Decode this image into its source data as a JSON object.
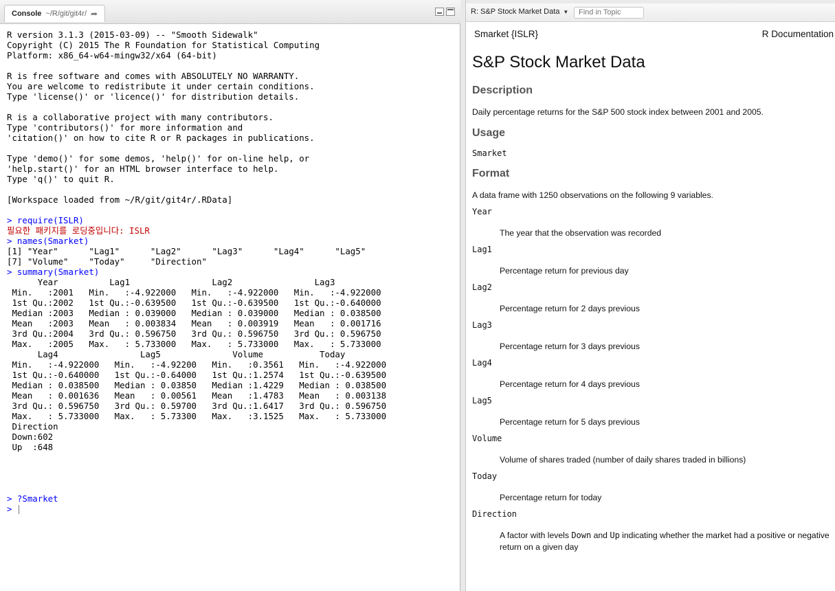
{
  "console": {
    "tab_title": "Console",
    "path": "~/R/git/git4r/",
    "lines": [
      {
        "kind": "out",
        "text": "R version 3.1.3 (2015-03-09) -- \"Smooth Sidewalk\""
      },
      {
        "kind": "out",
        "text": "Copyright (C) 2015 The R Foundation for Statistical Computing"
      },
      {
        "kind": "out",
        "text": "Platform: x86_64-w64-mingw32/x64 (64-bit)"
      },
      {
        "kind": "blank",
        "text": ""
      },
      {
        "kind": "out",
        "text": "R is free software and comes with ABSOLUTELY NO WARRANTY."
      },
      {
        "kind": "out",
        "text": "You are welcome to redistribute it under certain conditions."
      },
      {
        "kind": "out",
        "text": "Type 'license()' or 'licence()' for distribution details."
      },
      {
        "kind": "blank",
        "text": ""
      },
      {
        "kind": "out",
        "text": "R is a collaborative project with many contributors."
      },
      {
        "kind": "out",
        "text": "Type 'contributors()' for more information and"
      },
      {
        "kind": "out",
        "text": "'citation()' on how to cite R or R packages in publications."
      },
      {
        "kind": "blank",
        "text": ""
      },
      {
        "kind": "out",
        "text": "Type 'demo()' for some demos, 'help()' for on-line help, or"
      },
      {
        "kind": "out",
        "text": "'help.start()' for an HTML browser interface to help."
      },
      {
        "kind": "out",
        "text": "Type 'q()' to quit R."
      },
      {
        "kind": "blank",
        "text": ""
      },
      {
        "kind": "out",
        "text": "[Workspace loaded from ~/R/git/git4r/.RData]"
      },
      {
        "kind": "blank",
        "text": ""
      },
      {
        "kind": "cmd",
        "text": "> require(ISLR)"
      },
      {
        "kind": "err",
        "text": "필요한 패키지를 로딩중입니다: ISLR"
      },
      {
        "kind": "cmd",
        "text": "> names(Smarket)"
      },
      {
        "kind": "out",
        "text": "[1] \"Year\"      \"Lag1\"      \"Lag2\"      \"Lag3\"      \"Lag4\"      \"Lag5\""
      },
      {
        "kind": "out",
        "text": "[7] \"Volume\"    \"Today\"     \"Direction\""
      },
      {
        "kind": "cmd",
        "text": "> summary(Smarket)"
      },
      {
        "kind": "out",
        "text": "      Year          Lag1                Lag2                Lag3          "
      },
      {
        "kind": "out",
        "text": " Min.   :2001   Min.   :-4.922000   Min.   :-4.922000   Min.   :-4.922000  "
      },
      {
        "kind": "out",
        "text": " 1st Qu.:2002   1st Qu.:-0.639500   1st Qu.:-0.639500   1st Qu.:-0.640000  "
      },
      {
        "kind": "out",
        "text": " Median :2003   Median : 0.039000   Median : 0.039000   Median : 0.038500  "
      },
      {
        "kind": "out",
        "text": " Mean   :2003   Mean   : 0.003834   Mean   : 0.003919   Mean   : 0.001716  "
      },
      {
        "kind": "out",
        "text": " 3rd Qu.:2004   3rd Qu.: 0.596750   3rd Qu.: 0.596750   3rd Qu.: 0.596750  "
      },
      {
        "kind": "out",
        "text": " Max.   :2005   Max.   : 5.733000   Max.   : 5.733000   Max.   : 5.733000  "
      },
      {
        "kind": "out",
        "text": "      Lag4                Lag5              Volume           Today          "
      },
      {
        "kind": "out",
        "text": " Min.   :-4.922000   Min.   :-4.92200   Min.   :0.3561   Min.   :-4.922000  "
      },
      {
        "kind": "out",
        "text": " 1st Qu.:-0.640000   1st Qu.:-0.64000   1st Qu.:1.2574   1st Qu.:-0.639500  "
      },
      {
        "kind": "out",
        "text": " Median : 0.038500   Median : 0.03850   Median :1.4229   Median : 0.038500  "
      },
      {
        "kind": "out",
        "text": " Mean   : 0.001636   Mean   : 0.00561   Mean   :1.4783   Mean   : 0.003138  "
      },
      {
        "kind": "out",
        "text": " 3rd Qu.: 0.596750   3rd Qu.: 0.59700   3rd Qu.:1.6417   3rd Qu.: 0.596750  "
      },
      {
        "kind": "out",
        "text": " Max.   : 5.733000   Max.   : 5.73300   Max.   :3.1525   Max.   : 5.733000  "
      },
      {
        "kind": "out",
        "text": " Direction "
      },
      {
        "kind": "out",
        "text": " Down:602  "
      },
      {
        "kind": "out",
        "text": " Up  :648  "
      },
      {
        "kind": "blank",
        "text": ""
      },
      {
        "kind": "blank",
        "text": ""
      },
      {
        "kind": "blank",
        "text": ""
      },
      {
        "kind": "blank",
        "text": ""
      },
      {
        "kind": "cmd",
        "text": "> ?Smarket"
      },
      {
        "kind": "prompt",
        "text": "> "
      }
    ]
  },
  "help": {
    "topic": "R: S&P Stock Market Data",
    "find_placeholder": "Find in Topic",
    "header_left": "Smarket {ISLR}",
    "header_right": "R Documentation",
    "title": "S&P Stock Market Data",
    "sections": {
      "description_heading": "Description",
      "description_text": "Daily percentage returns for the S&P 500 stock index between 2001 and 2005.",
      "usage_heading": "Usage",
      "usage_code": "Smarket",
      "format_heading": "Format",
      "format_text": "A data frame with 1250 observations on the following 9 variables."
    },
    "variables": [
      {
        "name": "Year",
        "desc": "The year that the observation was recorded"
      },
      {
        "name": "Lag1",
        "desc": "Percentage return for previous day"
      },
      {
        "name": "Lag2",
        "desc": "Percentage return for 2 days previous"
      },
      {
        "name": "Lag3",
        "desc": "Percentage return for 3 days previous"
      },
      {
        "name": "Lag4",
        "desc": "Percentage return for 4 days previous"
      },
      {
        "name": "Lag5",
        "desc": "Percentage return for 5 days previous"
      },
      {
        "name": "Volume",
        "desc": "Volume of shares traded (number of daily shares traded in billions)"
      },
      {
        "name": "Today",
        "desc": "Percentage return for today"
      }
    ],
    "direction": {
      "name": "Direction",
      "desc_part1": "A factor with levels ",
      "level_down": "Down",
      "desc_part2": " and ",
      "level_up": "Up",
      "desc_part3": " indicating whether the market had a positive or negative return on a given day"
    }
  },
  "colors": {
    "command": "#0000ff",
    "error": "#c00000"
  }
}
